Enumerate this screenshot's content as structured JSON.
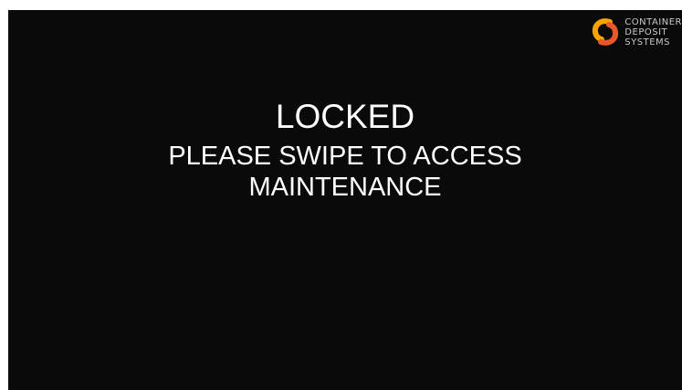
{
  "brand": {
    "logo_icon": "cds-swirl-logo-icon",
    "accent_colors": [
      "#f7a400",
      "#e9572a"
    ],
    "lines": [
      "CONTAINER",
      "DEPOSIT",
      "SYSTEMS"
    ]
  },
  "lock_screen": {
    "title": "LOCKED",
    "subtitle_lines": [
      "PLEASE SWIPE TO ACCESS",
      "MAINTENANCE"
    ]
  },
  "theme": {
    "background": "#0a0a0a",
    "text": "#ffffff"
  }
}
